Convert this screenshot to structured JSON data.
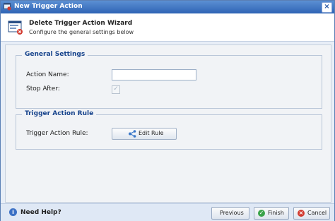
{
  "window": {
    "title": "New Trigger Action",
    "app_icon": "trigger-action-icon",
    "close_glyph": "×"
  },
  "header": {
    "title": "Delete Trigger Action Wizard",
    "subtitle": "Configure the general settings below",
    "icon": "wizard-icon"
  },
  "general_settings": {
    "legend": "General Settings",
    "action_name_label": "Action Name:",
    "action_name_value": "",
    "stop_after_label": "Stop After:",
    "stop_after_checked": true
  },
  "trigger_action_rule": {
    "legend": "Trigger Action Rule",
    "rule_label": "Trigger Action Rule:",
    "edit_rule_button": "Edit Rule",
    "edit_rule_icon": "share-icon"
  },
  "footer": {
    "help_label": "Need Help?",
    "help_icon": "info-icon",
    "previous_button": "Previous",
    "finish_button": "Finish",
    "cancel_button": "Cancel"
  },
  "colors": {
    "titlebar": "#2f64b5",
    "legend_text": "#15428b",
    "finish_icon": "#3aa34a",
    "cancel_icon": "#d23a2f"
  }
}
